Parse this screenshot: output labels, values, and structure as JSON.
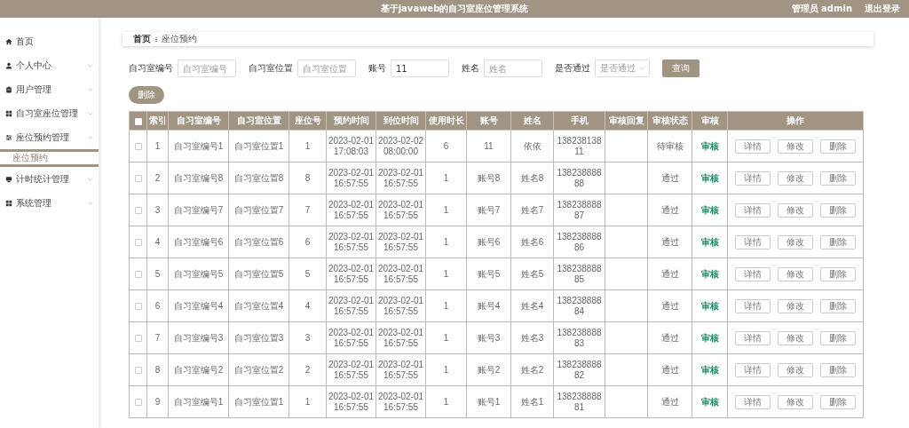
{
  "header": {
    "title": "基于javaweb的自习室座位管理系统",
    "user": "管理员 admin",
    "logout": "退出登录"
  },
  "sidebar": {
    "items": [
      {
        "label": "首页",
        "kind": "link"
      },
      {
        "label": "个人中心",
        "kind": "menu",
        "expanded": false
      },
      {
        "label": "用户管理",
        "kind": "menu",
        "expanded": false
      },
      {
        "label": "自习室座位管理",
        "kind": "menu",
        "expanded": false
      },
      {
        "label": "座位预约管理",
        "kind": "menu",
        "expanded": true,
        "children": [
          {
            "label": "座位预约",
            "selected": true
          }
        ]
      },
      {
        "label": "计时统计管理",
        "kind": "menu",
        "expanded": false
      },
      {
        "label": "系统管理",
        "kind": "menu",
        "expanded": false
      }
    ]
  },
  "breadcrumb": [
    "首页",
    "座位预约"
  ],
  "filters": [
    {
      "label": "自习室编号",
      "kind": "text",
      "placeholder": "自习室编号"
    },
    {
      "label": "自习室位置",
      "kind": "text",
      "placeholder": "自习室位置"
    },
    {
      "label": "账号",
      "kind": "text",
      "value": "11"
    },
    {
      "label": "姓名",
      "kind": "text",
      "placeholder": "姓名"
    },
    {
      "label": "是否通过",
      "kind": "select",
      "placeholder": "是否通过"
    }
  ],
  "search_button": "查询",
  "delete_button": "删除",
  "table": {
    "all_checked": false,
    "columns": [
      "索引",
      "自习室编号",
      "自习室位置",
      "座位号",
      "预约时间",
      "到位时间",
      "使用时长",
      "账号",
      "姓名",
      "手机",
      "审核回复",
      "审核状态",
      "审核",
      "操作"
    ],
    "rows": [
      {
        "checked": false,
        "cells": [
          "1",
          "自习室编号1",
          "自习室位置1",
          "1",
          "2023-02-01 17:08:03",
          "2023-02-02 08:00:00",
          "6",
          "11",
          "依依",
          "13823813811",
          "",
          "待审核"
        ],
        "review": "审核",
        "actions": [
          "详情",
          "修改",
          "删除"
        ]
      },
      {
        "checked": false,
        "cells": [
          "2",
          "自习室编号8",
          "自习室位置8",
          "8",
          "2023-02-01 16:57:55",
          "2023-02-01 16:57:55",
          "1",
          "账号8",
          "姓名8",
          "13823888888",
          "",
          "通过"
        ],
        "review": "审核",
        "actions": [
          "详情",
          "修改",
          "删除"
        ]
      },
      {
        "checked": false,
        "cells": [
          "3",
          "自习室编号7",
          "自习室位置7",
          "7",
          "2023-02-01 16:57:55",
          "2023-02-01 16:57:55",
          "1",
          "账号7",
          "姓名7",
          "13823888887",
          "",
          "通过"
        ],
        "review": "审核",
        "actions": [
          "详情",
          "修改",
          "删除"
        ]
      },
      {
        "checked": false,
        "cells": [
          "4",
          "自习室编号6",
          "自习室位置6",
          "6",
          "2023-02-01 16:57:55",
          "2023-02-01 16:57:55",
          "1",
          "账号6",
          "姓名6",
          "13823888886",
          "",
          "通过"
        ],
        "review": "审核",
        "actions": [
          "详情",
          "修改",
          "删除"
        ]
      },
      {
        "checked": false,
        "cells": [
          "5",
          "自习室编号5",
          "自习室位置5",
          "5",
          "2023-02-01 16:57:55",
          "2023-02-01 16:57:55",
          "1",
          "账号5",
          "姓名5",
          "13823888885",
          "",
          "通过"
        ],
        "review": "审核",
        "actions": [
          "详情",
          "修改",
          "删除"
        ]
      },
      {
        "checked": false,
        "cells": [
          "6",
          "自习室编号4",
          "自习室位置4",
          "4",
          "2023-02-01 16:57:55",
          "2023-02-01 16:57:55",
          "1",
          "账号4",
          "姓名4",
          "13823888884",
          "",
          "通过"
        ],
        "review": "审核",
        "actions": [
          "详情",
          "修改",
          "删除"
        ]
      },
      {
        "checked": false,
        "cells": [
          "7",
          "自习室编号3",
          "自习室位置3",
          "3",
          "2023-02-01 16:57:55",
          "2023-02-01 16:57:55",
          "1",
          "账号3",
          "姓名3",
          "13823888883",
          "",
          "通过"
        ],
        "review": "审核",
        "actions": [
          "详情",
          "修改",
          "删除"
        ]
      },
      {
        "checked": false,
        "cells": [
          "8",
          "自习室编号2",
          "自习室位置2",
          "2",
          "2023-02-01 16:57:55",
          "2023-02-01 16:57:55",
          "1",
          "账号2",
          "姓名2",
          "13823888882",
          "",
          "通过"
        ],
        "review": "审核",
        "actions": [
          "详情",
          "修改",
          "删除"
        ]
      },
      {
        "checked": false,
        "cells": [
          "9",
          "自习室编号1",
          "自习室位置1",
          "1",
          "2023-02-01 16:57:55",
          "2023-02-01 16:57:55",
          "1",
          "账号1",
          "姓名1",
          "13823888881",
          "",
          "通过"
        ],
        "review": "审核",
        "actions": [
          "详情",
          "修改",
          "删除"
        ]
      }
    ]
  }
}
